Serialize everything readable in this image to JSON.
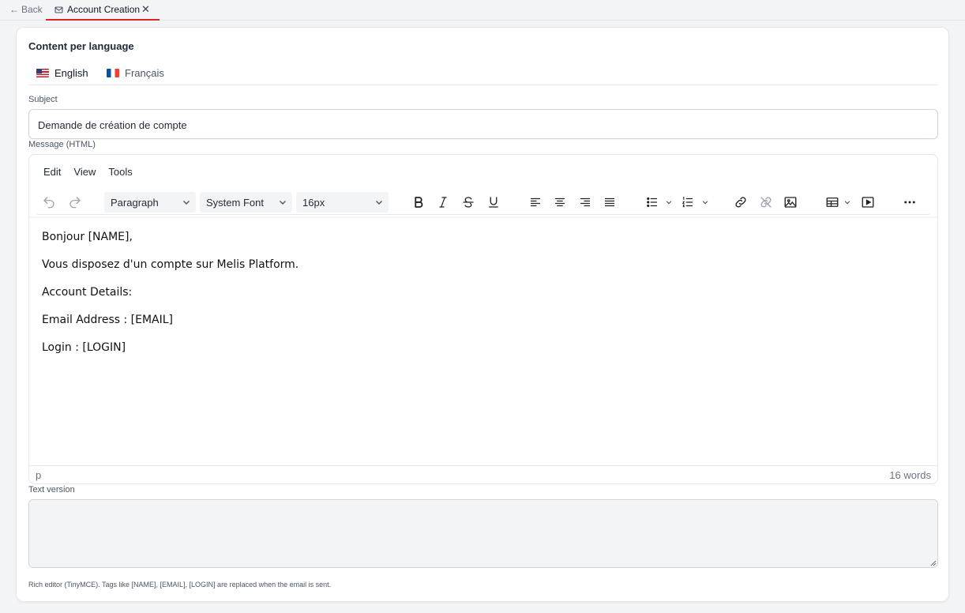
{
  "tabbar": {
    "back_label": "Back",
    "tab_label": "Account Creation"
  },
  "card": {
    "section_title": "Content per language",
    "languages": [
      {
        "label": "English",
        "active": true
      },
      {
        "label": "Français",
        "active": false
      }
    ],
    "subject": {
      "label": "Subject",
      "value": "Demande de création de compte"
    },
    "message_label": "Message (HTML)",
    "editor": {
      "menu": [
        "Edit",
        "View",
        "Tools"
      ],
      "block_format": "Paragraph",
      "font_family": "System Font",
      "font_size": "16px",
      "content": [
        "Bonjour [NAME],",
        "Vous disposez d'un compte sur Melis Platform.",
        "Account Details:",
        "Email Address : [EMAIL]",
        "Login : [LOGIN]"
      ],
      "status_path": "p",
      "word_count": "16 words"
    },
    "text_version_label": "Text version",
    "text_version_value": "",
    "hint": "Rich editor (TinyMCE). Tags like [NAME], [EMAIL], [LOGIN] are replaced when the email is sent."
  },
  "colors": {
    "accent": "#dc2626",
    "background": "#f3f4f6"
  }
}
